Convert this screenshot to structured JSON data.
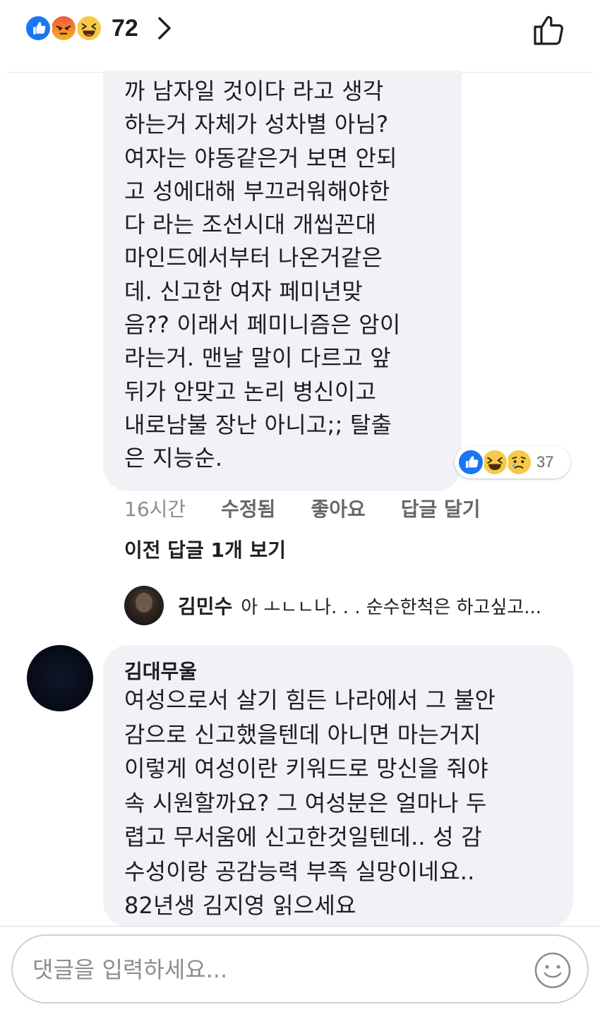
{
  "header": {
    "reactions": [
      "like-icon",
      "angry-icon",
      "haha-icon"
    ],
    "reaction_count": "72",
    "chevron": "chevron-right-icon",
    "like_button": "thumbs-up-outline-icon"
  },
  "comment1": {
    "text": "까 남자일 것이다 라고 생각\n하는거 자체가 성차별 아님?\n여자는 야동같은거 보면 안되\n고 성에대해 부끄러워해야한\n다 라는 조선시대 개씹꼰대\n마인드에서부터 나온거같은\n데. 신고한 여자 페미년맞\n음?? 이래서 페미니즘은 암이\n라는거. 맨날 말이 다르고 앞\n뒤가 안맞고 논리 병신이고\n내로남불 장난 아니고;; 탈출\n은 지능순.",
    "reactions": [
      "like-icon",
      "haha-icon",
      "sad-icon"
    ],
    "reaction_count": "37",
    "time": "16시간",
    "edited": "수정됨",
    "like": "좋아요",
    "reply": "답글 달기",
    "view_prev_replies": "이전 답글 1개 보기",
    "latest_reply": {
      "name": "김민수",
      "text": "아  ㅗㄴㄴ나. . . 순수한척은 하고싶고..."
    }
  },
  "comment2": {
    "name": "김대무울",
    "text": "여성으로서 살기 힘든 나라에서 그 불안\n감으로 신고했을텐데 아니면 마는거지\n이렇게 여성이란 키워드로 망신을 줘야\n속 시원할까요? 그 여성분은 얼마나 두\n렵고 무서움에 신고한것일텐데.. 성 감\n수성이랑 공감능력 부족 실망이네요..\n82년생 김지영 읽으세요"
  },
  "composer": {
    "placeholder": "댓글을 입력하세요...",
    "emoji": "smiley-icon"
  },
  "colors": {
    "like_blue": "#1877f2",
    "bubble_bg": "#f0f2f5",
    "meta_gray": "#65676b"
  }
}
